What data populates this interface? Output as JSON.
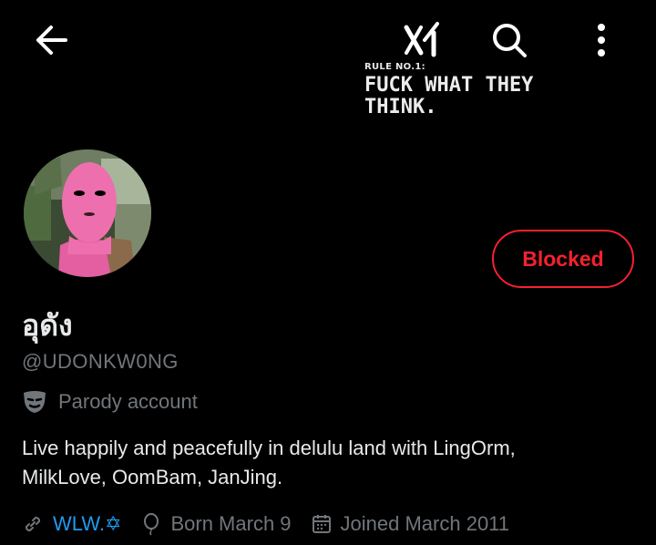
{
  "header": {
    "back_icon": "arrow-left-icon",
    "grok_icon": "xai-grok-icon",
    "search_icon": "search-icon",
    "more_icon": "more-vertical-icon"
  },
  "banner": {
    "small_text": "RULE NO.1:",
    "big_text": "FUCK WHAT THEY THINK."
  },
  "profile": {
    "display_name": "อุดัง",
    "handle": "@UDONKW0NG",
    "label_icon": "theater-mask-icon",
    "label": "Parody account",
    "bio": "Live happily and peacefully in delulu land with LingOrm, MilkLove, OomBam, JanJing.",
    "blocked_label": "Blocked"
  },
  "meta": {
    "website": "WLW.✡",
    "birthday": "Born March 9",
    "joined": "Joined March 2011"
  },
  "colors": {
    "background": "#000000",
    "text": "#e7e9ea",
    "secondary": "#71767b",
    "link": "#1d9bf0",
    "blocked": "#f4212e"
  }
}
